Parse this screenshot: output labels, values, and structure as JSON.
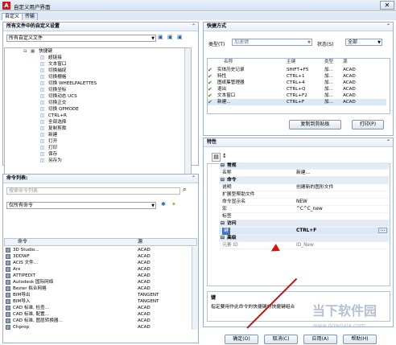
{
  "window": {
    "title": "自定义用户界面"
  },
  "tabs": [
    "自定义",
    "传输"
  ],
  "left_panel": {
    "title": "所有文件中的自定义设置",
    "selector_value": "所有自定义文件",
    "tree_items": [
      "快捷键",
      "超链接",
      "文本窗口",
      "切换捕捉",
      "切换栅格",
      "切换 WHEELPALETTES",
      "切换坐标",
      "切换动态 UCS",
      "切换正交",
      "切换 QPMODE",
      "CTRL+R",
      "全部选择",
      "复制剪裁",
      "新建",
      "打开",
      "打印",
      "保存",
      "另存为"
    ],
    "commands": {
      "title": "命令列表:",
      "search_placeholder": "搜索命令列表",
      "filter_value": "仅所有命令",
      "headers": [
        "命令",
        "源"
      ],
      "rows": [
        {
          "name": "3D Studio...",
          "src": "ACAD"
        },
        {
          "name": "3DDWF",
          "src": "ACAD"
        },
        {
          "name": "ACIS 文件...",
          "src": "ACAD"
        },
        {
          "name": "Arx",
          "src": "ACAD"
        },
        {
          "name": "ATTIPEDIT",
          "src": "ACAD"
        },
        {
          "name": "Autodesk 国际网络",
          "src": "ACAD"
        },
        {
          "name": "Bezier 拟合网格",
          "src": "ACAD"
        },
        {
          "name": "BIM导出",
          "src": "TANGENT"
        },
        {
          "name": "BIM导入",
          "src": "TANGENT"
        },
        {
          "name": "CAD 标准, 检查...",
          "src": "ACAD"
        },
        {
          "name": "CAD 标准, 配置...",
          "src": "ACAD"
        },
        {
          "name": "CAD 标准, 图层转换器...",
          "src": "ACAD"
        },
        {
          "name": "Chprop",
          "src": "ACAD"
        }
      ]
    }
  },
  "shortcuts_panel": {
    "title": "快捷方式",
    "type_label": "类型(T)",
    "type_value": "加速键",
    "status_label": "状态(S)",
    "status_value": "全部",
    "headers": [
      "名称",
      "主键",
      "类型",
      "源"
    ],
    "rows": [
      {
        "name": "实体历史记录",
        "key": "SHIFT+F5",
        "type": "加...",
        "src": "ACAD"
      },
      {
        "name": "特性",
        "key": "CTRL+1",
        "type": "加...",
        "src": "ACAD"
      },
      {
        "name": "图纸集管理器",
        "key": "CTRL+4",
        "type": "加...",
        "src": "ACAD"
      },
      {
        "name": "退出",
        "key": "CTRL+Q",
        "type": "加...",
        "src": "ACAD"
      },
      {
        "name": "文本窗口",
        "key": "CTRL+F2",
        "type": "加...",
        "src": "ACAD"
      },
      {
        "name": "新建...",
        "key": "CTRL+F",
        "type": "加...",
        "src": "ACAD"
      }
    ],
    "copy_button": "复制到剪贴板",
    "print_button": "打印(P)"
  },
  "properties_panel": {
    "title": "特性",
    "groups": [
      {
        "label": "常规",
        "rows": [
          {
            "k": "名称",
            "v": "新建..."
          }
        ]
      },
      {
        "label": "命令",
        "rows": [
          {
            "k": "说明",
            "v": "创建新的图形文件"
          },
          {
            "k": "扩展型帮助文件",
            "v": ""
          },
          {
            "k": "命令显示名",
            "v": "NEW"
          },
          {
            "k": "宏",
            "v": "^C^C_new"
          },
          {
            "k": "标签",
            "v": ""
          }
        ]
      },
      {
        "label": "访问",
        "rows": [
          {
            "k": "键",
            "v": "CTRL+F"
          }
        ]
      },
      {
        "label": "高级",
        "rows": [
          {
            "k": "元素 ID",
            "v": "ID_New"
          }
        ]
      }
    ],
    "desc_title": "键",
    "desc_text": "指定要用作此命令的快捷键的快捷键组合"
  },
  "buttons": {
    "ok": "确定(O)",
    "cancel": "取消(C)",
    "apply": "应用(A)",
    "help": "帮助(H)"
  },
  "watermark": {
    "main": "当下软件园",
    "sub": "www.downxia.com"
  },
  "colors": {
    "accent": "#d31313",
    "check": "#2a8c26"
  }
}
